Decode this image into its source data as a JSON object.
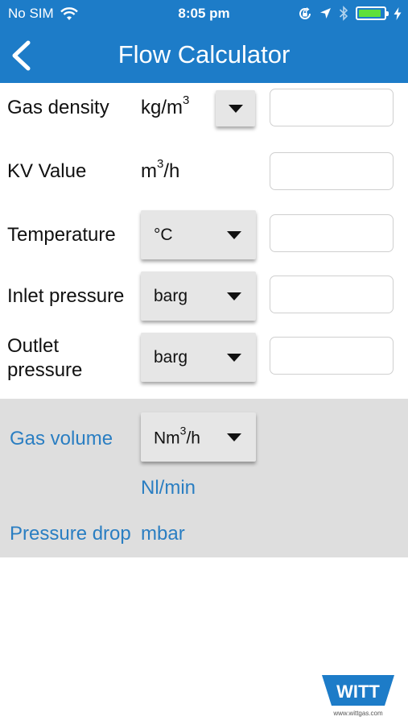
{
  "status": {
    "carrier": "No SIM",
    "time": "8:05 pm",
    "battery_level": 0.92,
    "icons": [
      "wifi-icon",
      "orientation-lock-icon",
      "location-arrow-icon",
      "bluetooth-icon",
      "battery-icon",
      "charging-bolt-icon"
    ]
  },
  "nav": {
    "title": "Flow Calculator",
    "back_icon": "chevron-left-icon"
  },
  "form": {
    "gas_density": {
      "label": "Gas density",
      "unit": "kg/m",
      "unit_sup": "3",
      "value": ""
    },
    "kv_value": {
      "label": "KV Value",
      "unit_prefix": "m",
      "unit_sup": "3",
      "unit_suffix": "/h",
      "value": ""
    },
    "temperature": {
      "label": "Temperature",
      "unit": "°C",
      "value": ""
    },
    "inlet_pressure": {
      "label": "Inlet pressure",
      "unit": "barg",
      "value": ""
    },
    "outlet_pressure": {
      "label_line1": "Outlet",
      "label_line2": "pressure",
      "unit": "barg",
      "value": ""
    }
  },
  "results": {
    "gas_volume": {
      "label": "Gas volume",
      "unit_prefix": "Nm",
      "unit_sup": "3",
      "unit_suffix": "/h",
      "alt_unit": "Nl/min"
    },
    "pressure_drop": {
      "label": "Pressure drop",
      "unit": "mbar"
    }
  },
  "logo": {
    "text": "WITT",
    "url": "www.wittgas.com"
  },
  "colors": {
    "brand": "#1d7cc8",
    "result_text": "#2a7ec2",
    "result_bg": "#dedede",
    "dropdown_bg": "#e6e6e6"
  }
}
